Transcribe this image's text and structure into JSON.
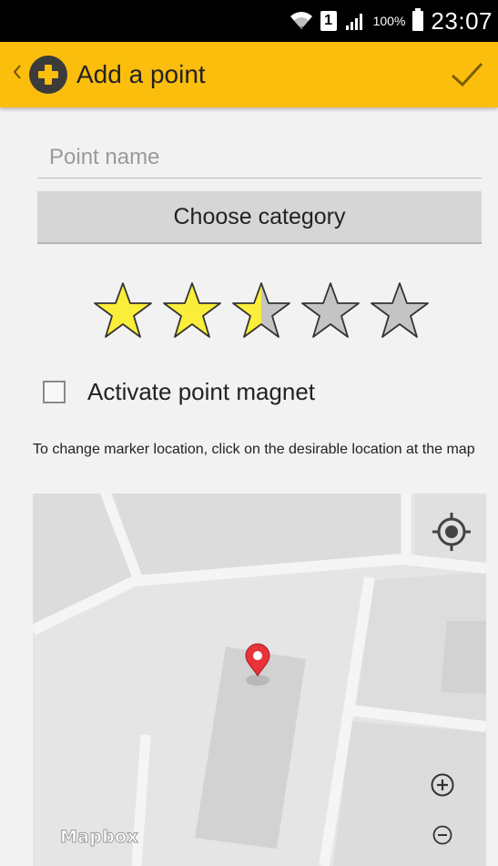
{
  "status_bar": {
    "battery_percent": "100%",
    "time": "23:07",
    "sim_slot": "1",
    "icons": [
      "wifi-icon",
      "sim-icon",
      "signal-icon",
      "battery-icon"
    ]
  },
  "action_bar": {
    "title": "Add a point",
    "back_icon": "chevron-left-icon",
    "logo_icon": "plus-circle-icon",
    "confirm_icon": "checkmark-icon",
    "color": "#fcbe0d"
  },
  "form": {
    "name_placeholder": "Point name",
    "name_value": "",
    "category_button_label": "Choose category",
    "rating": {
      "value": 2.5,
      "max": 5
    },
    "magnet_label": "Activate point magnet",
    "magnet_checked": false,
    "hint": "To change marker location, click on the desirable location at the map"
  },
  "map": {
    "attribution": "Mapbox",
    "locate_icon": "crosshair-icon",
    "zoom_in_icon": "zoom-in-icon",
    "zoom_out_icon": "zoom-out-icon",
    "marker_icon": "map-pin-icon",
    "marker_color": "#e8333a"
  },
  "colors": {
    "star_filled": "#fbee3a",
    "star_empty": "#c4c4c4"
  }
}
